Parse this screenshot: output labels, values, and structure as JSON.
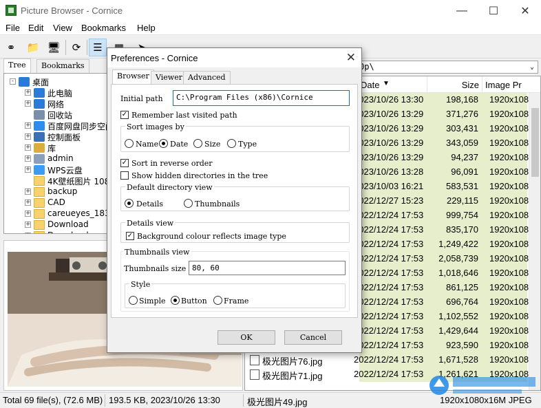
{
  "window": {
    "title": "Picture Browser - Cornice"
  },
  "menu": [
    "File",
    "Edit",
    "View",
    "Bookmarks",
    "Help"
  ],
  "left_tabs": [
    "Tree",
    "Bookmarks"
  ],
  "tree": [
    {
      "label": "桌面",
      "level": 0,
      "expander": "-",
      "icon": "desktop-icon"
    },
    {
      "label": "此电脑",
      "level": 1,
      "expander": "+",
      "icon": "computer-icon"
    },
    {
      "label": "网络",
      "level": 1,
      "expander": "+",
      "icon": "network-icon"
    },
    {
      "label": "回收站",
      "level": 1,
      "expander": "",
      "icon": "recycle-bin-icon"
    },
    {
      "label": "百度网盘同步空间",
      "level": 1,
      "expander": "+",
      "icon": "cloud-sync-icon"
    },
    {
      "label": "控制面板",
      "level": 1,
      "expander": "+",
      "icon": "control-panel-icon"
    },
    {
      "label": "库",
      "level": 1,
      "expander": "+",
      "icon": "library-icon"
    },
    {
      "label": "admin",
      "level": 1,
      "expander": "+",
      "icon": "user-icon"
    },
    {
      "label": "WPS云盘",
      "level": 1,
      "expander": "+",
      "icon": "cloud-icon"
    },
    {
      "label": "4K壁纸图片 1080p",
      "level": 1,
      "expander": "",
      "icon": "folder-icon"
    },
    {
      "label": "backup",
      "level": 1,
      "expander": "+",
      "icon": "folder-icon"
    },
    {
      "label": "CAD",
      "level": 1,
      "expander": "+",
      "icon": "folder-icon"
    },
    {
      "label": "careueyes_183211",
      "level": 1,
      "expander": "+",
      "icon": "folder-icon"
    },
    {
      "label": "Download",
      "level": 1,
      "expander": "+",
      "icon": "folder-icon"
    },
    {
      "label": "Download",
      "level": 1,
      "expander": "+",
      "icon": "folder-icon"
    }
  ],
  "path": "0p\\",
  "columns": {
    "date": "Date",
    "size": "Size",
    "image": "Image Pr"
  },
  "files": [
    {
      "name": "",
      "date": "2023/10/26 13:30",
      "size": "198,168",
      "res": "1920x108"
    },
    {
      "name": "",
      "date": "2023/10/26 13:29",
      "size": "371,276",
      "res": "1920x108"
    },
    {
      "name": "",
      "date": "2023/10/26 13:29",
      "size": "303,431",
      "res": "1920x108"
    },
    {
      "name": "",
      "date": "2023/10/26 13:29",
      "size": "343,059",
      "res": "1920x108"
    },
    {
      "name": "",
      "date": "2023/10/26 13:29",
      "size": "94,237",
      "res": "1920x108"
    },
    {
      "name": "",
      "date": "2023/10/26 13:28",
      "size": "96,091",
      "res": "1920x108"
    },
    {
      "name": "",
      "date": "2023/10/03 16:21",
      "size": "583,531",
      "res": "1920x108"
    },
    {
      "name": "",
      "date": "2022/12/27 15:23",
      "size": "229,115",
      "res": "1920x108"
    },
    {
      "name": "",
      "date": "2022/12/24 17:53",
      "size": "999,754",
      "res": "1920x108"
    },
    {
      "name": "",
      "date": "2022/12/24 17:53",
      "size": "835,170",
      "res": "1920x108"
    },
    {
      "name": "",
      "date": "2022/12/24 17:53",
      "size": "1,249,422",
      "res": "1920x108"
    },
    {
      "name": "",
      "date": "2022/12/24 17:53",
      "size": "2,058,739",
      "res": "1920x108"
    },
    {
      "name": "",
      "date": "2022/12/24 17:53",
      "size": "1,018,646",
      "res": "1920x108"
    },
    {
      "name": "",
      "date": "2022/12/24 17:53",
      "size": "861,125",
      "res": "1920x108"
    },
    {
      "name": "",
      "date": "2022/12/24 17:53",
      "size": "696,764",
      "res": "1920x108"
    },
    {
      "name": "",
      "date": "2022/12/24 17:53",
      "size": "1,102,552",
      "res": "1920x108"
    },
    {
      "name": "",
      "date": "2022/12/24 17:53",
      "size": "1,429,644",
      "res": "1920x108"
    },
    {
      "name": "",
      "date": "2022/12/24 17:53",
      "size": "923,590",
      "res": "1920x108"
    },
    {
      "name": "极光图片76.jpg",
      "date": "2022/12/24 17:53",
      "size": "1,671,528",
      "res": "1920x108"
    },
    {
      "name": "极光图片71.jpg",
      "date": "2022/12/24 17:53",
      "size": "1,261,621",
      "res": "1920x108"
    }
  ],
  "status": {
    "total": "Total 69 file(s), (72.6 MB)",
    "selected": "193.5 KB, 2023/10/26 13:30",
    "filename": "极光图片49.jpg",
    "info": "1920x1080x16M JPEG"
  },
  "dialog": {
    "title": "Preferences - Cornice",
    "tabs": [
      "Browser",
      "Viewer",
      "Advanced"
    ],
    "initial_path_label": "Initial path",
    "initial_path_value": "C:\\Program Files (x86)\\Cornice",
    "remember_label": "Remember last visited path",
    "sort_title": "Sort images by",
    "sort_options": [
      "Name",
      "Date",
      "Size",
      "Type"
    ],
    "sort_reverse_label": "Sort in reverse order",
    "show_hidden_label": "Show hidden directories in the tree",
    "default_view_title": "Default directory view",
    "view_options": [
      "Details",
      "Thumbnails"
    ],
    "details_view_title": "Details view",
    "bg_colour_label": "Background colour reflects image type",
    "thumbs_view_title": "Thumbnails view",
    "thumbs_size_label": "Thumbnails size",
    "thumbs_size_value": "80, 60",
    "style_title": "Style",
    "style_options": [
      "Simple",
      "Button",
      "Frame"
    ],
    "ok_label": "OK",
    "cancel_label": "Cancel"
  },
  "colors": {
    "row_highlight": "#e6eecb",
    "accent": "#0078d7"
  }
}
